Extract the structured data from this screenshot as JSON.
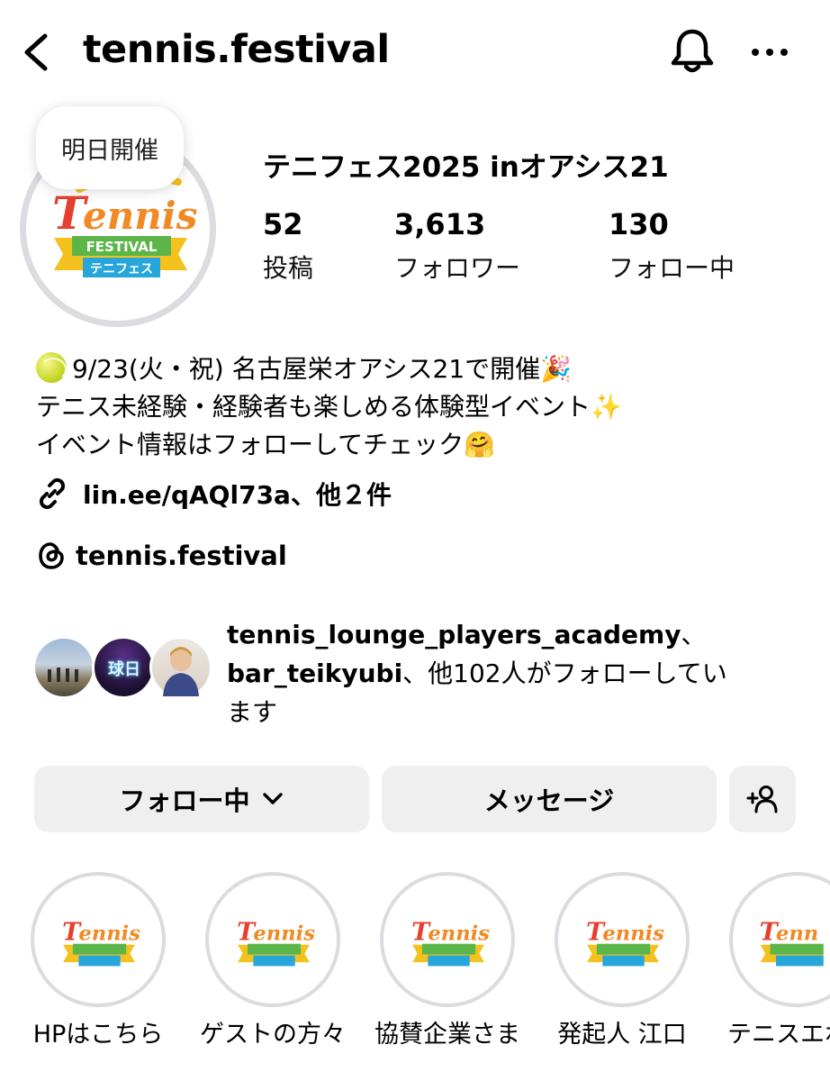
{
  "header": {
    "username": "tennis.festival",
    "back_icon": "chevron-left-icon",
    "notification_icon": "bell-icon",
    "more_icon": "ellipsis-icon"
  },
  "profile": {
    "note": "明日開催",
    "display_name": "テニフェス2025 inオアシス21",
    "stats": [
      {
        "value": "52",
        "label": "投稿"
      },
      {
        "value": "3,613",
        "label": "フォロワー"
      },
      {
        "value": "130",
        "label": "フォロー中"
      }
    ],
    "avatar_logo": {
      "line1": "Tennis",
      "line2": "FESTIVAL",
      "line3": "テニフェス"
    }
  },
  "bio": {
    "line1": "9/23(火・祝) 名古屋栄オアシス21で開催🎉",
    "line2": "テニス未経験・経験者も楽しめる体験型イベント✨",
    "line3": "イベント情報はフォローしてチェック🤗",
    "link": "lin.ee/qAQl73a、他２件",
    "threads": "tennis.festival"
  },
  "followed_by": {
    "bold1": "tennis_lounge_players_academy",
    "sep1": "、",
    "bold2": "bar_teikyubi",
    "rest1": "、他102人がフォローしてい",
    "rest2": "ます",
    "avatar2_text": "球日"
  },
  "actions": {
    "following": "フォロー中",
    "message": "メッセージ",
    "add_user_icon": "person-add-icon"
  },
  "highlights": [
    {
      "label": "HPはこちら"
    },
    {
      "label": "ゲストの方々"
    },
    {
      "label": "協賛企業さま"
    },
    {
      "label": "発起人 江口"
    },
    {
      "label": "テニスエボ"
    }
  ],
  "colors": {
    "logo_orange": "#f08a24",
    "logo_red": "#e5402f",
    "logo_green": "#5bb548",
    "logo_yellow": "#f4c21e",
    "logo_blue": "#26a6d9",
    "button_bg": "#efefef"
  }
}
